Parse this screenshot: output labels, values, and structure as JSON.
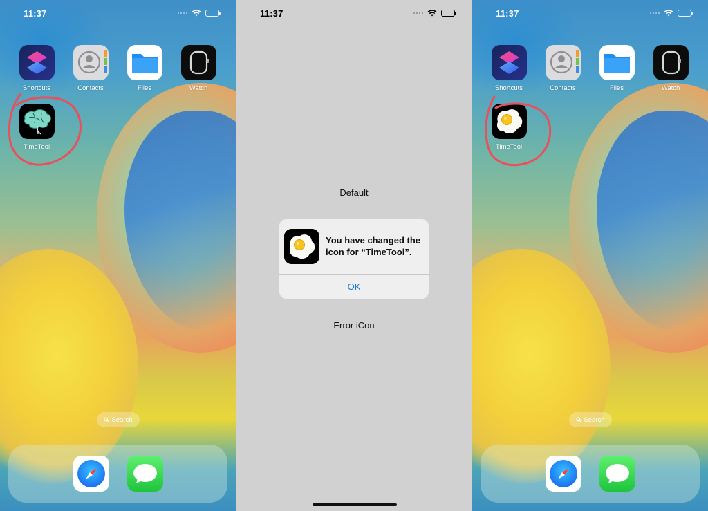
{
  "left_screen": {
    "time": "11:37",
    "apps": [
      {
        "label": "Shortcuts",
        "icon": "shortcuts-icon"
      },
      {
        "label": "Contacts",
        "icon": "contacts-icon"
      },
      {
        "label": "Files",
        "icon": "files-icon"
      },
      {
        "label": "Watch",
        "icon": "watch-icon"
      }
    ],
    "timetool": {
      "label": "TimeTool",
      "icon": "tree-icon"
    },
    "search_label": "Search",
    "dock": [
      {
        "icon": "safari-icon"
      },
      {
        "icon": "messages-icon"
      }
    ],
    "annotation_color": "#e8505b"
  },
  "middle_screen": {
    "time": "11:37",
    "default_label": "Default",
    "alert": {
      "message": "You have changed the icon for “TimeTool”.",
      "ok_label": "OK",
      "icon": "fried-egg-icon"
    },
    "error_label": "Error iCon",
    "background": "#d1d1d1",
    "accent": "#1a7bd6"
  },
  "right_screen": {
    "time": "11:37",
    "apps": [
      {
        "label": "Shortcuts",
        "icon": "shortcuts-icon"
      },
      {
        "label": "Contacts",
        "icon": "contacts-icon"
      },
      {
        "label": "Files",
        "icon": "files-icon"
      },
      {
        "label": "Watch",
        "icon": "watch-icon"
      }
    ],
    "timetool": {
      "label": "TimeTool",
      "icon": "fried-egg-icon"
    },
    "search_label": "Search",
    "dock": [
      {
        "icon": "safari-icon"
      },
      {
        "icon": "messages-icon"
      }
    ],
    "annotation_color": "#e8505b"
  }
}
